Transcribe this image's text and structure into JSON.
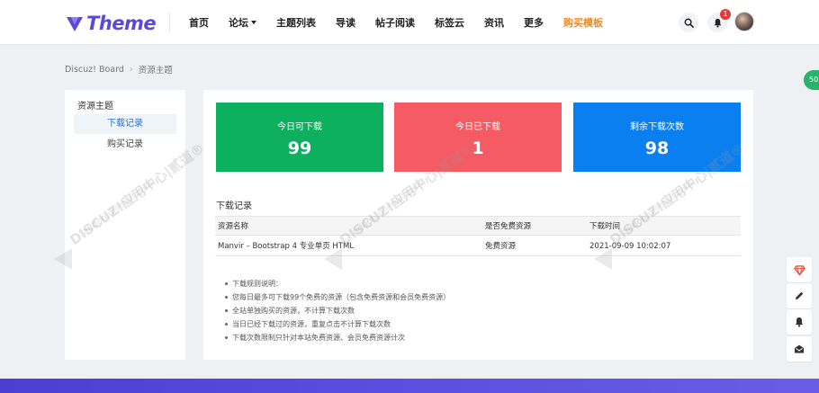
{
  "header": {
    "logo_text": "Theme",
    "nav": [
      {
        "label": "首页"
      },
      {
        "label": "论坛",
        "has_dropdown": true
      },
      {
        "label": "主题列表"
      },
      {
        "label": "导读"
      },
      {
        "label": "帖子阅读"
      },
      {
        "label": "标签云"
      },
      {
        "label": "资讯"
      },
      {
        "label": "更多"
      },
      {
        "label": "购买模板",
        "highlight": true
      }
    ],
    "notification_count": "1"
  },
  "edge_tab": "50",
  "breadcrumb": {
    "root": "Discuz! Board",
    "separator": "›",
    "current": "资源主题"
  },
  "sidebar": {
    "title": "资源主题",
    "items": [
      {
        "label": "下载记录",
        "active": true
      },
      {
        "label": "购买记录",
        "active": false
      }
    ]
  },
  "stats": [
    {
      "label": "今日可下载",
      "value": "99",
      "color": "#0db05e"
    },
    {
      "label": "今日已下载",
      "value": "1",
      "color": "#f55b65"
    },
    {
      "label": "剩余下载次数",
      "value": "98",
      "color": "#0a7ff0"
    }
  ],
  "download_section": {
    "title": "下载记录",
    "columns": [
      "资源名称",
      "是否免费资源",
      "下载时间"
    ],
    "rows": [
      [
        "Manvir – Bootstrap 4 专业单页 HTML",
        "免费资源",
        "2021-09-09 10:02:07"
      ]
    ]
  },
  "notes": [
    "下载规则说明：",
    "您每日最多可下载99个免费的资源（包含免费资源和会员免费资源）",
    "全站单独购买的资源，不计算下载次数",
    "当日已经下载过的资源，重复点击不计算下载次数",
    "下载次数限制只针对本站免费资源、会员免费资源计次"
  ],
  "watermark": {
    "main": "DISCUZ!应用中心|贰道®",
    "sub": "addon.dismall.com"
  },
  "tools": [
    "diamond-icon",
    "pencil-icon",
    "bell-icon",
    "mail-icon"
  ],
  "colors": {
    "brand": "#5a49d8",
    "accent_orange": "#f08a24",
    "link_blue": "#1a73e8",
    "footer": "#5a4fe0"
  }
}
